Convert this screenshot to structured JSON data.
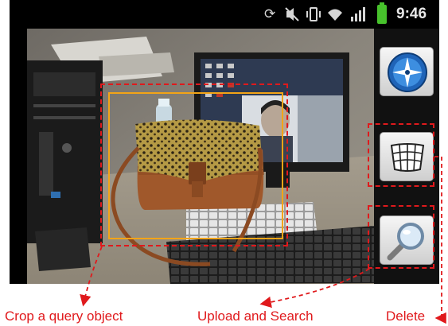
{
  "status_bar": {
    "time": "9:46",
    "icons": [
      "sync-icon",
      "vibrate-mute-icon",
      "vibrate-icon",
      "wifi-icon",
      "signal-icon",
      "battery-icon"
    ]
  },
  "side_buttons": [
    {
      "name": "compass-button",
      "icon": "compass-icon"
    },
    {
      "name": "crop-grid-button",
      "icon": "grid-icon"
    },
    {
      "name": "search-button",
      "icon": "magnifier-icon"
    }
  ],
  "annotations": {
    "crop": "Crop a query object",
    "upload": "Upload and Search",
    "delete": "Delete"
  },
  "colors": {
    "annotation": "#e0191c",
    "crop_rect": "#f3a417",
    "battery": "#47c22c"
  }
}
